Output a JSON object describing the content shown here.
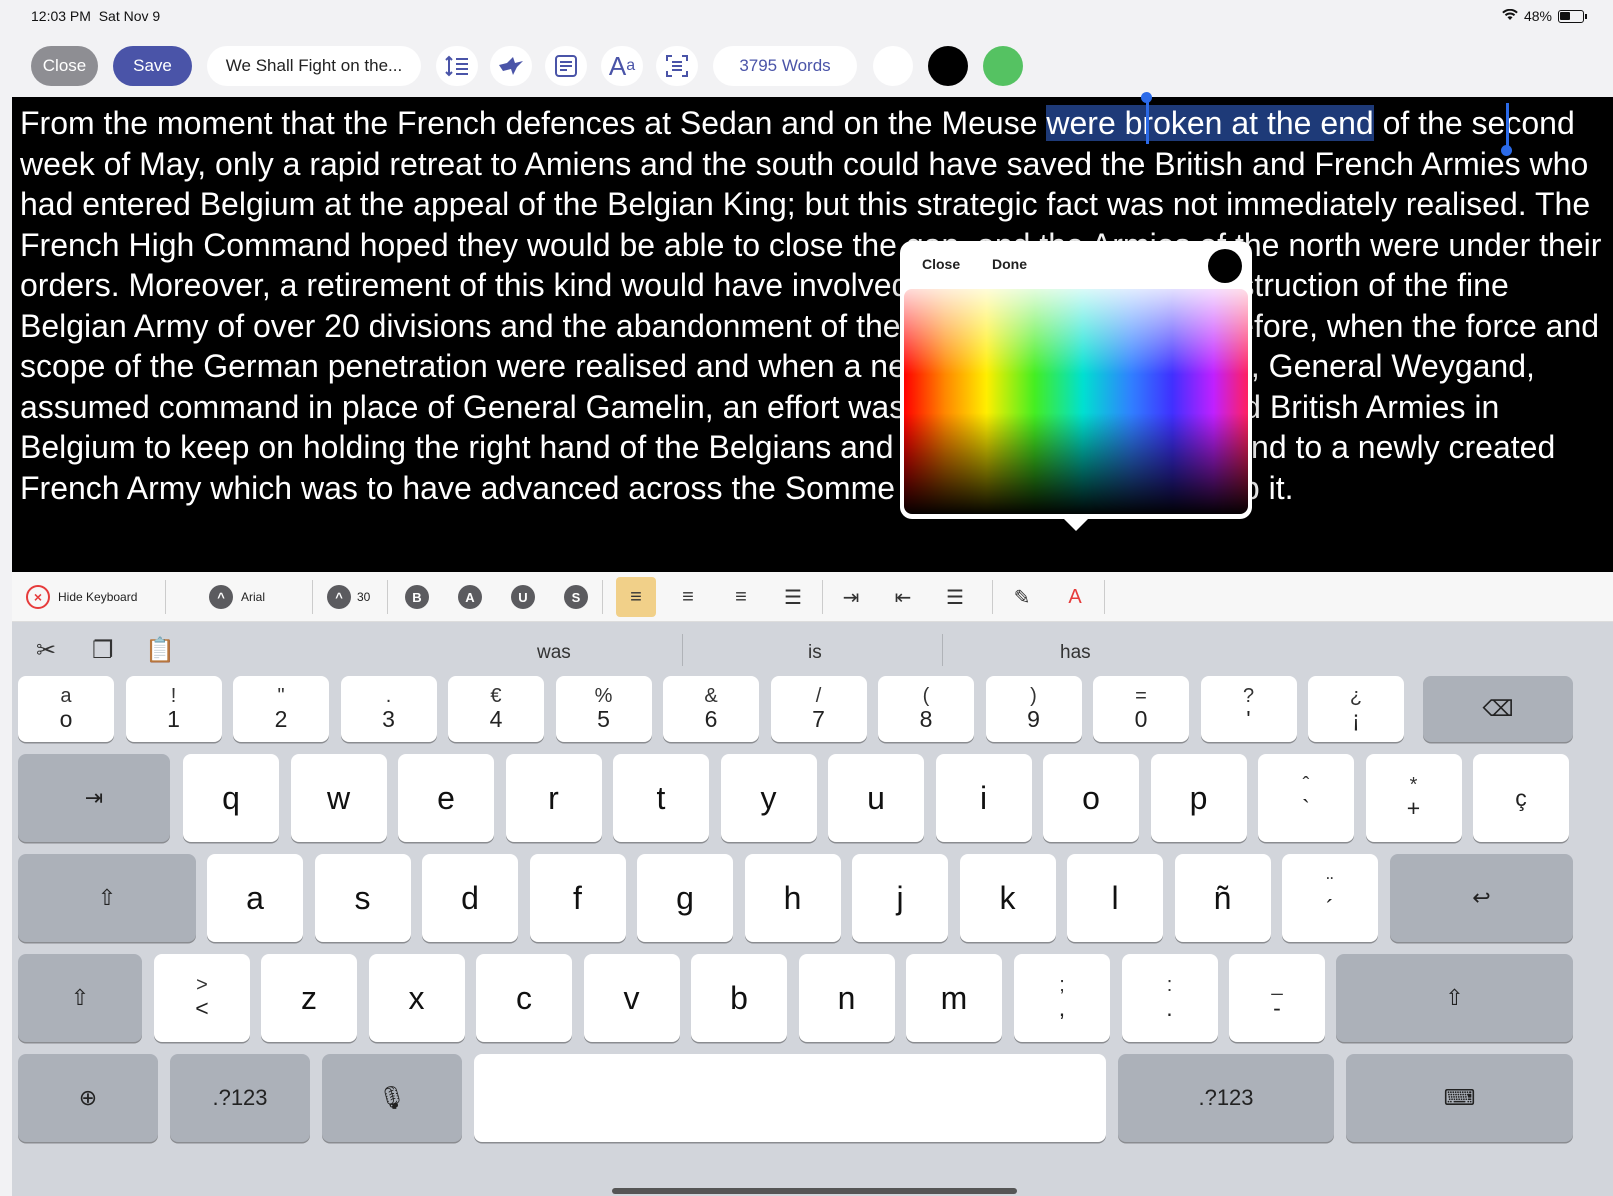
{
  "status_bar": {
    "time": "12:03 PM",
    "date": "Sat Nov 9",
    "battery": "48%",
    "icons": [
      "wifi-icon",
      "battery-icon"
    ]
  },
  "toolbar": {
    "close_label": "Close",
    "save_label": "Save",
    "title": "We Shall Fight on the...",
    "word_count": "3795 Words",
    "icons": [
      "line-spacing-icon",
      "bird-icon",
      "notes-icon",
      "font-size-icon",
      "document-scan-icon"
    ],
    "swatches": [
      "#ffffff",
      "#000000",
      "#55c262"
    ]
  },
  "editor": {
    "before": "From the moment that the French defences at Sedan and on the Meuse ",
    "selected": "were broken at the end",
    "after": " of the second week of May, only a rapid retreat to Amiens and the south could have saved the British and French Armies who had entered Belgium at the appeal of the Belgian King; but this strategic fact was not immediately realised. The French High Command hoped they would be able to close the gap, and the Armies of the north were under their orders. Moreover, a retirement of this kind would have involved almost certainly the destruction of the fine Belgian Army of over 20 divisions and the abandonment of the whole of Belgium. Therefore, when the force and scope of the German penetration were realised and when a new French Generalissimo, General Weygand, assumed command in place of General Gamelin, an effort was made by the French and British Armies in Belgium to keep on holding the right hand of the Belgians and to give their own right hand to a newly created French Army which was to have advanced across the Somme in great strength to grasp it.",
    "background": "#000000",
    "text_color": "#ffffff"
  },
  "color_picker": {
    "close_label": "Close",
    "done_label": "Done",
    "selected_color": "#000000"
  },
  "format_bar": {
    "hide_keyboard": "Hide Keyboard",
    "font": "Arial",
    "font_size": "30",
    "style_buttons": [
      "B",
      "A",
      "U",
      "S"
    ],
    "align_buttons": [
      "align-left-icon",
      "align-center-icon",
      "align-right-icon",
      "align-justify-icon"
    ],
    "indent_buttons": [
      "indent-icon",
      "outdent-icon",
      "list-icon"
    ],
    "active_align": "align-left-icon",
    "highlighter_icon": "highlighter-icon",
    "text_color_label": "A",
    "text_color": "#e63b3b"
  },
  "keyboard": {
    "suggestions": [
      "was",
      "is",
      "has"
    ],
    "row1": [
      {
        "top": "a",
        "bot": "o"
      },
      {
        "top": "!",
        "bot": "1"
      },
      {
        "top": "\"",
        "bot": "2"
      },
      {
        "top": ".",
        "bot": "3"
      },
      {
        "top": "€",
        "bot": "4"
      },
      {
        "top": "%",
        "bot": "5"
      },
      {
        "top": "&",
        "bot": "6"
      },
      {
        "top": "/",
        "bot": "7"
      },
      {
        "top": "(",
        "bot": "8"
      },
      {
        "top": ")",
        "bot": "9"
      },
      {
        "top": "=",
        "bot": "0"
      },
      {
        "top": "?",
        "bot": "'"
      },
      {
        "top": "¿",
        "bot": "¡"
      }
    ],
    "row2": [
      "q",
      "w",
      "e",
      "r",
      "t",
      "y",
      "u",
      "i",
      "o",
      "p"
    ],
    "row2_extra": [
      {
        "top": "ˆ",
        "bot": "`"
      },
      {
        "top": "*",
        "bot": "+"
      },
      {
        "top": "",
        "bot": "ç"
      }
    ],
    "row3": [
      "a",
      "s",
      "d",
      "f",
      "g",
      "h",
      "j",
      "k",
      "l",
      "ñ"
    ],
    "row3_extra": {
      "top": "¨",
      "bot": "´"
    },
    "row4_first": {
      "top": ">",
      "bot": "<"
    },
    "row4": [
      "z",
      "x",
      "c",
      "v",
      "b",
      "n",
      "m"
    ],
    "row4_extra": [
      {
        "top": ";",
        "bot": ","
      },
      {
        "top": ":",
        "bot": "."
      },
      {
        "top": "_",
        "bot": "-"
      }
    ],
    "num_label": ".?123",
    "tab_glyph": "⇥",
    "delete_glyph": "⌫",
    "return_glyph": "↩",
    "shift_glyph": "⇧",
    "globe_glyph": "⊕",
    "mic_glyph": "🎙",
    "keyboard_glyph": "⌨"
  }
}
